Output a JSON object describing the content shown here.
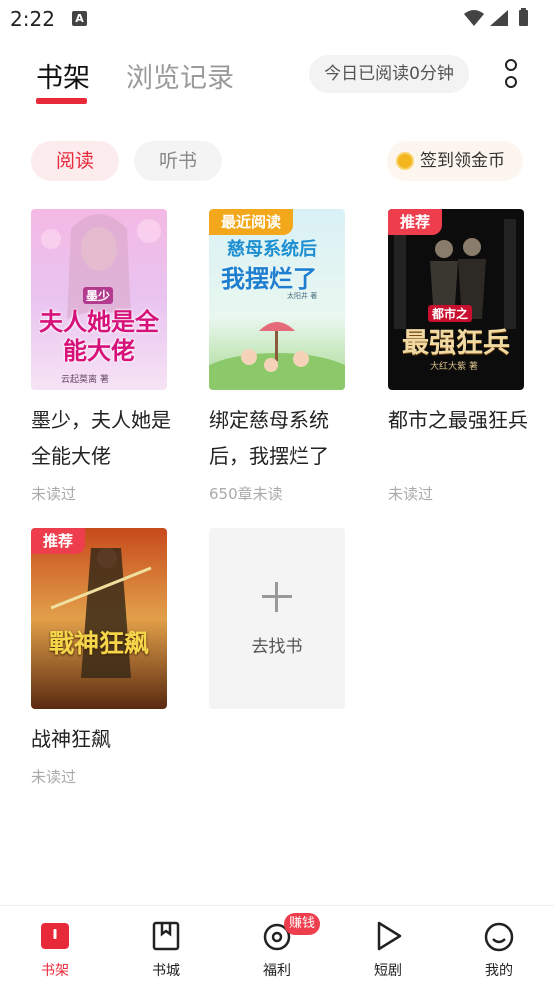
{
  "status_bar": {
    "time": "2:22",
    "notification_glyph": "A"
  },
  "header": {
    "tab_shelf": "书架",
    "tab_history": "浏览记录",
    "read_today": "今日已阅读0分钟"
  },
  "filters": {
    "read": "阅读",
    "listen": "听书",
    "signin": "签到领金币"
  },
  "books": [
    {
      "title": "墨少，夫人她是全能大佬",
      "status": "未读过",
      "tag": "",
      "cover_text": "夫人她是全能大佬",
      "cover_sub": "墨少",
      "author": "云起莫离 著"
    },
    {
      "title": "绑定慈母系统后，我摆烂了",
      "status": "650章未读",
      "tag": "最近阅读",
      "cover_text": "慈母系统后",
      "cover_text2": "我摆烂了",
      "author": "太阳井 著"
    },
    {
      "title": "都市之最强狂兵",
      "status": "未读过",
      "tag": "推荐",
      "cover_text": "最强狂兵",
      "cover_sub": "都市之",
      "author": "大红大紫 著"
    },
    {
      "title": "战神狂飙",
      "status": "未读过",
      "tag": "推荐",
      "cover_text": "戰神狂飙"
    }
  ],
  "find_book": {
    "label": "去找书"
  },
  "bottom_nav": {
    "items": [
      {
        "label": "书架"
      },
      {
        "label": "书城"
      },
      {
        "label": "福利"
      },
      {
        "label": "短剧"
      },
      {
        "label": "我的"
      }
    ],
    "earn_badge": "赚钱"
  },
  "colors": {
    "accent": "#e8293a",
    "tag_gold": "#f3a81c",
    "tag_red": "#ee3d4c"
  },
  "icons": [
    "battery-icon",
    "signal-icon",
    "wifi-icon",
    "more-vertical-icon",
    "coin-icon",
    "plus-icon",
    "bookshelf-icon",
    "bookstore-icon",
    "welfare-icon",
    "play-icon",
    "profile-icon"
  ]
}
